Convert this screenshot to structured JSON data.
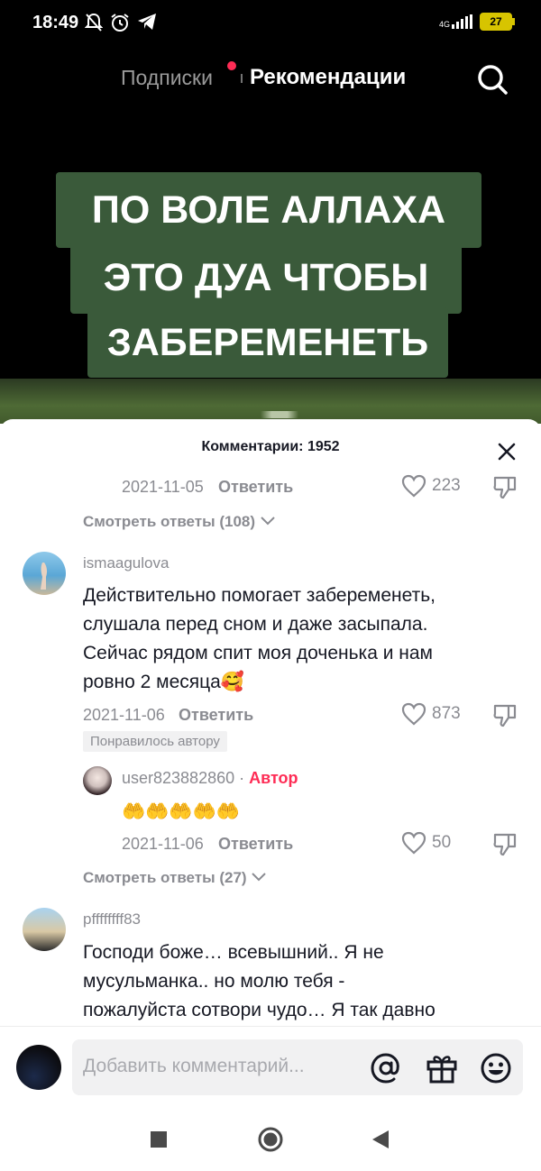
{
  "status_bar": {
    "time": "18:49",
    "network": "4G",
    "battery": "27"
  },
  "top_nav": {
    "following": "Подписки",
    "for_you": "Рекомендации"
  },
  "video": {
    "caption_lines": [
      "ПО ВОЛЕ АЛЛАХА",
      "ЭТО ДУА ЧТОБЫ",
      "ЗАБЕРЕМЕНЕТЬ"
    ]
  },
  "comments_panel": {
    "title": "Комментарии: 1952",
    "top_partial": {
      "date": "2021-11-05",
      "reply": "Ответить",
      "likes": "223",
      "view_replies": "Смотреть ответы (108)"
    },
    "comment_1": {
      "username": "ismaagulova",
      "lines": [
        "Действительно помогает забеременеть,",
        "слушала перед сном и даже засыпала.",
        "Сейчас рядом спит моя доченька и нам",
        "ровно 2 месяца🥰"
      ],
      "date": "2021-11-06",
      "reply": "Ответить",
      "likes": "873",
      "liked_by_author": "Понравилось автору"
    },
    "reply_1": {
      "username": "user823882860",
      "separator": "·",
      "author_label": "Автор",
      "text": "🤲🤲🤲🤲🤲",
      "date": "2021-11-06",
      "reply": "Ответить",
      "likes": "50"
    },
    "comment_1_view_replies": "Смотреть ответы (27)",
    "comment_2": {
      "username": "pffffffff83",
      "lines": [
        "Господи боже… всевышний.. Я не",
        "мусульманка.. но молю тебя -",
        "пожалуйста сотвори чудо… Я так давно"
      ]
    }
  },
  "input": {
    "placeholder": "Добавить комментарий..."
  },
  "icons": [
    "search-icon",
    "close-icon",
    "heart-icon",
    "dislike-icon",
    "chevron-down-icon",
    "mention-icon",
    "gift-icon",
    "emoji-icon",
    "square-icon",
    "circle-icon",
    "back-triangle-icon"
  ],
  "colors": {
    "accent": "#fe2c55",
    "caption_bg": "#3a5a3a",
    "muted": "#8a8b91",
    "text": "#161823"
  }
}
